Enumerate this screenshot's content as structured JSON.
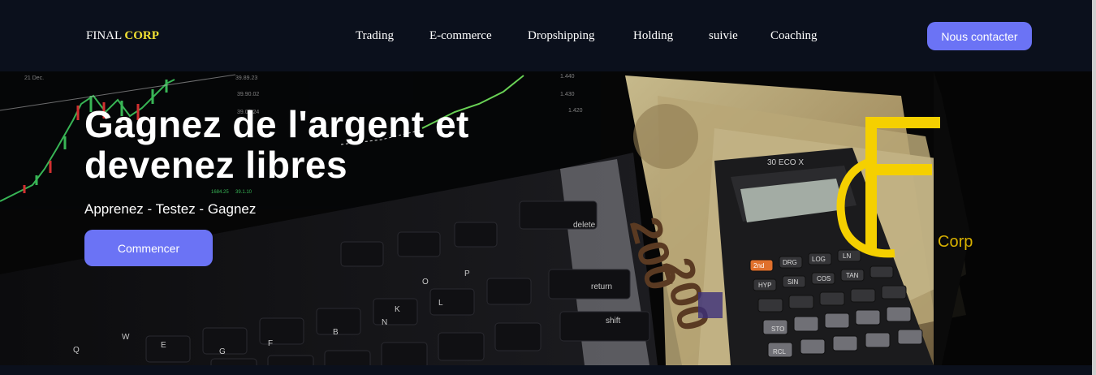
{
  "nav": {
    "brand_prefix": "FINAL ",
    "brand_highlight": "CORP",
    "links": [
      "Trading",
      "E-commerce",
      "Dropshipping",
      "Holding",
      "suivie",
      "Coaching"
    ],
    "contact_label": "Nous contacter"
  },
  "hero": {
    "title_line1": "Gagnez de l'argent et",
    "title_line2": "devenez libres",
    "subtitle": "Apprenez - Testez - Gagnez",
    "start_label": "Commencer"
  },
  "logo": {
    "corp_text": "Corp"
  },
  "colors": {
    "nav_bg": "#0b101c",
    "accent": "#6b73f5",
    "brand_highlight": "#f2e033",
    "logo_yellow": "#f5d000"
  }
}
